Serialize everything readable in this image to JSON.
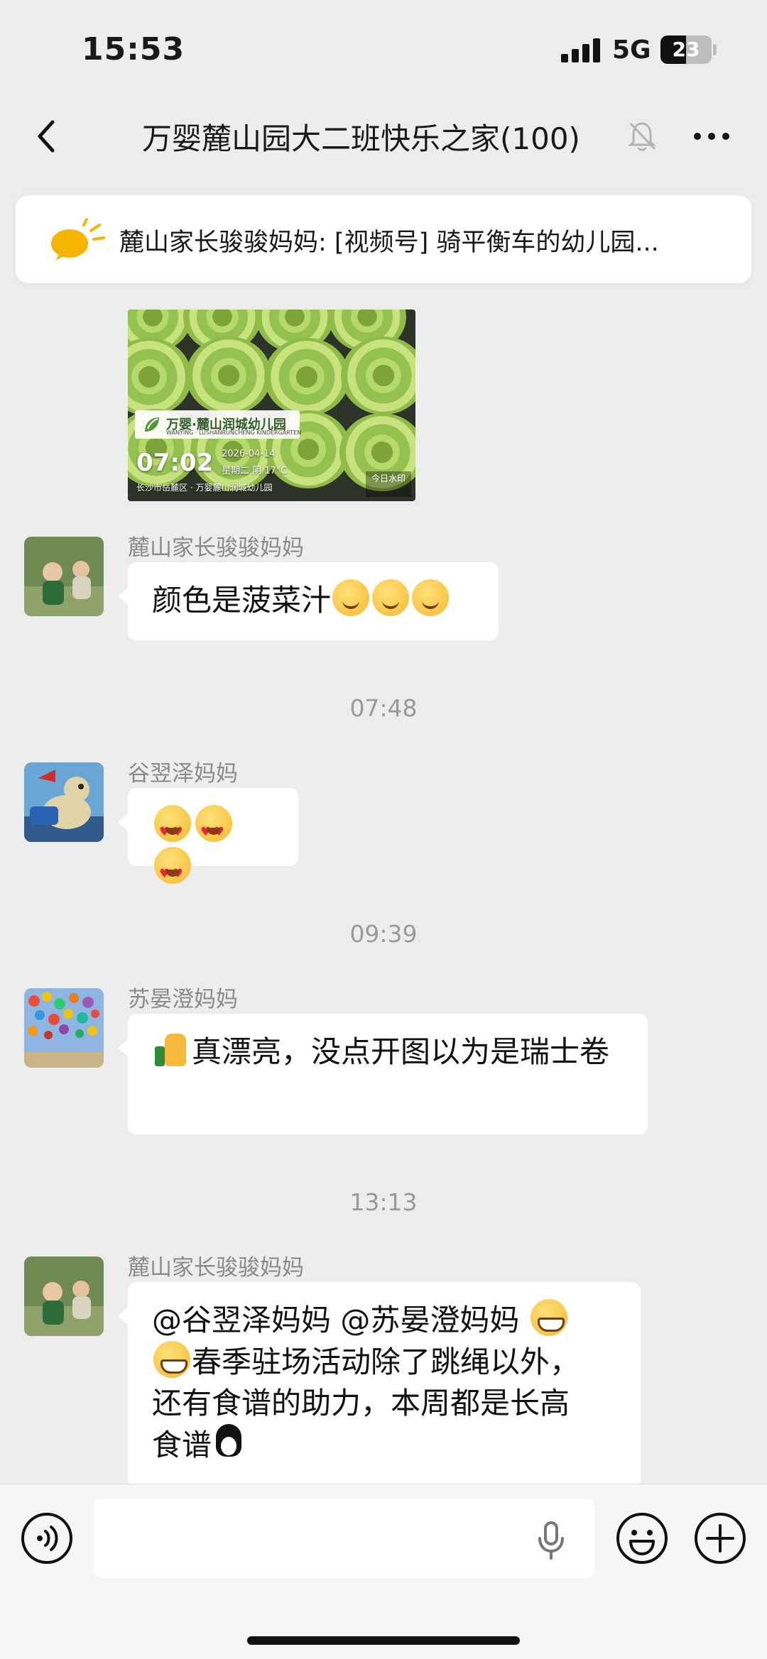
{
  "status_bar": {
    "time": "15:53",
    "network": "5G",
    "battery": "23"
  },
  "nav": {
    "title": "万婴麓山园大二班快乐之家(100)"
  },
  "pinned": {
    "text": "麓山家长骏骏妈妈: [视频号] 骑平衡车的幼儿园..."
  },
  "photo": {
    "watermark_logo": "万婴·麓山润城幼儿园",
    "watermark_logo_sub": "WANYING · LUSHANRUNCHENG KINDERGARTEN",
    "watermark_time": "07:02",
    "watermark_date": "2026-04-14",
    "watermark_weekday": "星期二 阴 17°C",
    "watermark_location": "长沙市岳麓区 · 万婴麓山润城幼儿园",
    "watermark_badge": "今日水印"
  },
  "messages": [
    {
      "sender": "麓山家长骏骏妈妈",
      "text": "颜色是菠菜汁",
      "avatar": "children-photo"
    },
    {
      "timestamp": "07:48"
    },
    {
      "sender": "谷翌泽妈妈",
      "avatar": "toy-dinosaur"
    },
    {
      "timestamp": "09:39"
    },
    {
      "sender": "苏晏澄妈妈",
      "text": "真漂亮，没点开图以为是瑞士卷",
      "avatar": "balloons"
    },
    {
      "timestamp": "13:13"
    },
    {
      "sender": "麓山家长骏骏妈妈",
      "text_line1": "@谷翌泽妈妈 @苏晏澄妈妈 ",
      "text_line2": "春季驻场活动除了跳绳以外，",
      "text_line3": "还有食谱的助力，本周都是长高",
      "text_line4": "食谱",
      "avatar": "children-photo"
    }
  ],
  "colors": {
    "background": "#EDEDED",
    "bubble": "#FFFFFF",
    "muted_text": "#8A8A8A"
  }
}
